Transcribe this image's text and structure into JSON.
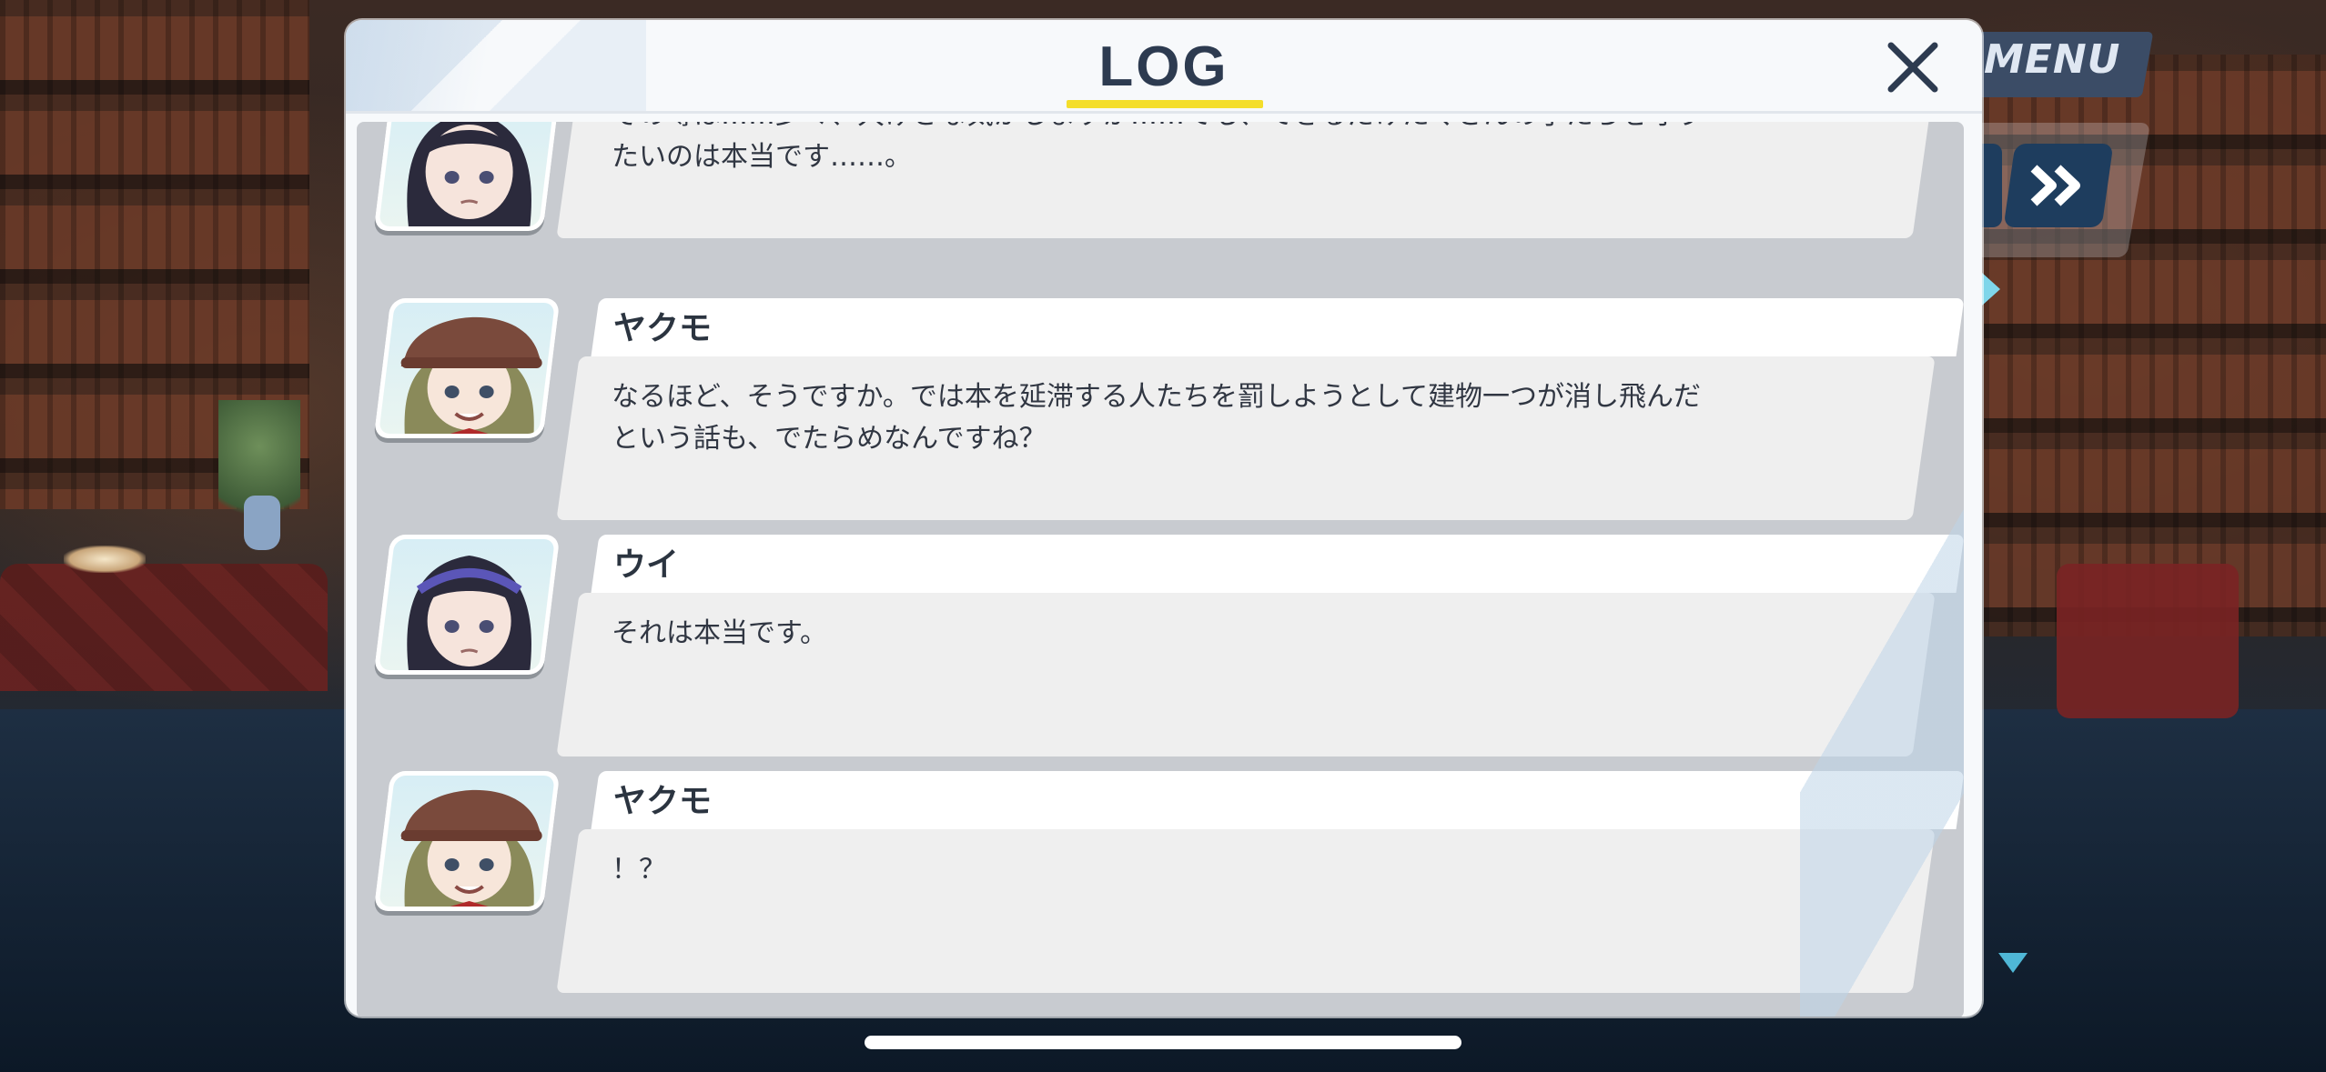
{
  "hud": {
    "menu_label": "MENU",
    "fast_forward_icon": "double-chevron-right-icon",
    "accent_color": "#1e3d5e"
  },
  "dialog": {
    "title": "LOG",
    "close_icon": "close-icon",
    "title_underline_color": "#f4de2b"
  },
  "log": {
    "entries": [
      {
        "speaker": "",
        "portrait": "ui-portrait",
        "text": "その噂は……少々、大げさな気がしますが……でも、できるだけたくさんの子たちを守りたいのは本当です……。"
      },
      {
        "speaker": "ヤクモ",
        "portrait": "yakumo-portrait",
        "text": "なるほど、そうですか。では本を延滞する人たちを罰しようとして建物一つが消し飛んだという話も、でたらめなんですね？"
      },
      {
        "speaker": "ウイ",
        "portrait": "ui-portrait",
        "text": "それは本当です。"
      },
      {
        "speaker": "ヤクモ",
        "portrait": "yakumo-portrait",
        "text": "！？"
      }
    ]
  }
}
